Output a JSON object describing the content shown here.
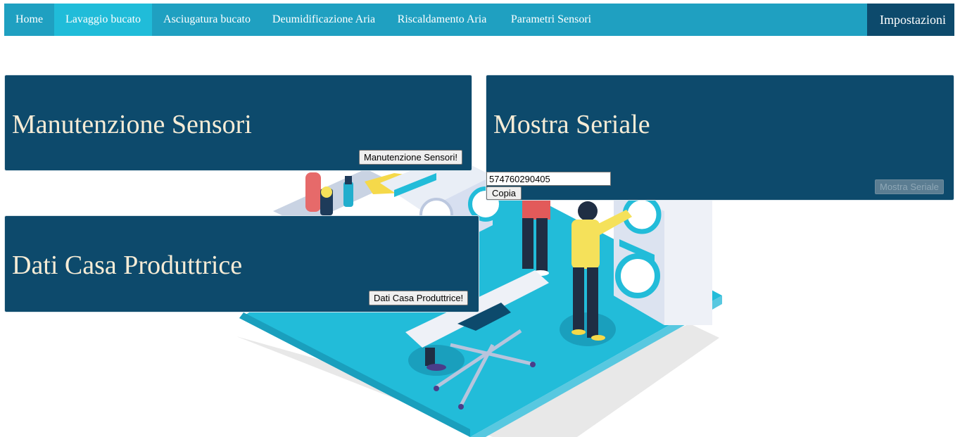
{
  "nav": {
    "items": [
      {
        "label": "Home",
        "active": false
      },
      {
        "label": "Lavaggio bucato",
        "active": true
      },
      {
        "label": "Asciugatura bucato",
        "active": false
      },
      {
        "label": "Deumidificazione Aria",
        "active": false
      },
      {
        "label": "Riscaldamento Aria",
        "active": false
      },
      {
        "label": "Parametri Sensori",
        "active": false
      }
    ],
    "right_label": "Impostazioni",
    "colors": {
      "bar": "#1fa0c1",
      "active": "#20bcd9",
      "right": "#0d4a6c"
    }
  },
  "panels": {
    "manutenzione": {
      "title": "Manutenzione Sensori",
      "button": "Manutenzione Sensori!"
    },
    "seriale": {
      "title": "Mostra Seriale",
      "button": "Mostra Seriale",
      "serial_value": "574760290405",
      "copy_button": "Copia"
    },
    "produttrice": {
      "title": "Dati Casa Produttrice",
      "button": "Dati Casa Produttrice!"
    }
  },
  "theme": {
    "panel_bg": "#0d4a6c",
    "title_color": "#f6ecd6"
  },
  "background": {
    "illustration": "laundry-room-illustration"
  }
}
